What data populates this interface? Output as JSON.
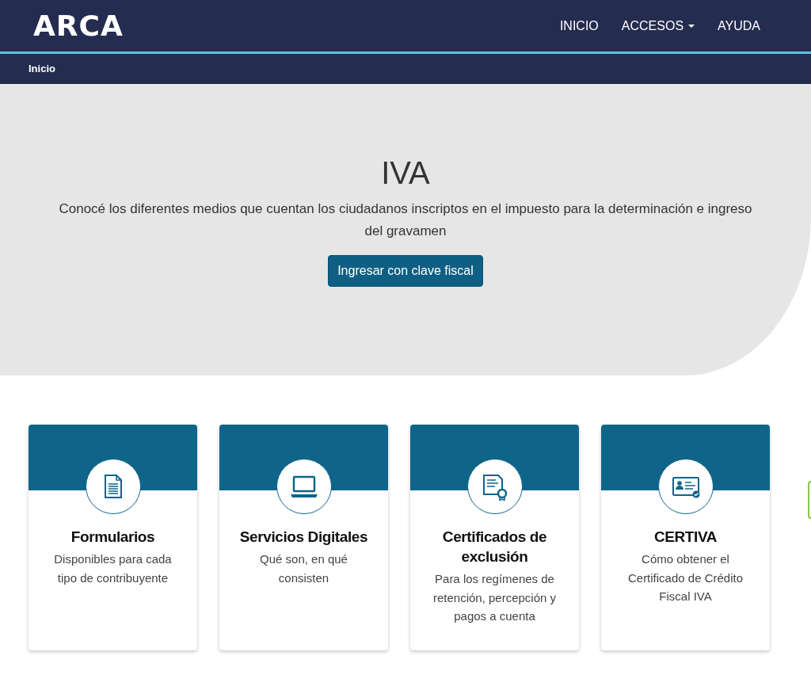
{
  "header": {
    "logo": "ARCA",
    "nav": [
      {
        "label": "INICIO",
        "dropdown": false
      },
      {
        "label": "ACCESOS",
        "dropdown": true
      },
      {
        "label": "AYUDA",
        "dropdown": false
      }
    ]
  },
  "breadcrumb": "Inicio",
  "hero": {
    "title": "IVA",
    "text": "Conocé los diferentes medios que cuentan los ciudadanos inscriptos en el impuesto para la determinación e ingreso del gravamen",
    "button": "Ingresar con clave fiscal"
  },
  "cards": [
    {
      "kind": "document",
      "title": "Formularios",
      "text": "Disponibles para cada tipo de contribuyente"
    },
    {
      "kind": "laptop",
      "title": "Servicios Digitales",
      "text": "Qué son, en qué consisten"
    },
    {
      "kind": "certificate",
      "title": "Certificados de exclusión",
      "text": "Para los regímenes de retención, percepción y pagos a cuenta"
    },
    {
      "kind": "idcard",
      "title": "CERTIVA",
      "text": "Cómo obtener el Certificado de Crédito Fiscal IVA"
    }
  ]
}
